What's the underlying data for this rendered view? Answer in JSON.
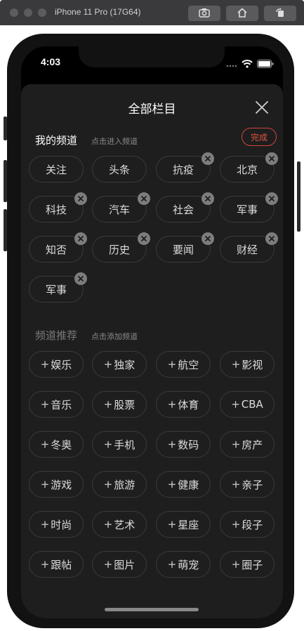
{
  "simulator": {
    "title": "iPhone 11 Pro (17G64)"
  },
  "status_bar": {
    "time": "4:03"
  },
  "sheet": {
    "title": "全部栏目",
    "done_label": "完成",
    "my_channels": {
      "title": "我的频道",
      "hint": "点击进入频道",
      "items": [
        {
          "label": "关注",
          "removable": false
        },
        {
          "label": "头条",
          "removable": false
        },
        {
          "label": "抗疫",
          "removable": true
        },
        {
          "label": "北京",
          "removable": true
        },
        {
          "label": "科技",
          "removable": true
        },
        {
          "label": "汽车",
          "removable": true
        },
        {
          "label": "社会",
          "removable": true
        },
        {
          "label": "军事",
          "removable": true
        },
        {
          "label": "知否",
          "removable": true
        },
        {
          "label": "历史",
          "removable": true
        },
        {
          "label": "要闻",
          "removable": true
        },
        {
          "label": "财经",
          "removable": true
        },
        {
          "label": "军事",
          "removable": true
        }
      ]
    },
    "recommended": {
      "title": "频道推荐",
      "hint": "点击添加频道",
      "items": [
        "娱乐",
        "独家",
        "航空",
        "影视",
        "音乐",
        "股票",
        "体育",
        "CBA",
        "冬奥",
        "手机",
        "数码",
        "房产",
        "游戏",
        "旅游",
        "健康",
        "亲子",
        "时尚",
        "艺术",
        "星座",
        "段子",
        "跟帖",
        "图片",
        "萌宠",
        "圈子"
      ]
    }
  },
  "colors": {
    "accent": "#e0523f",
    "sheet_bg": "#1e1e1e"
  }
}
